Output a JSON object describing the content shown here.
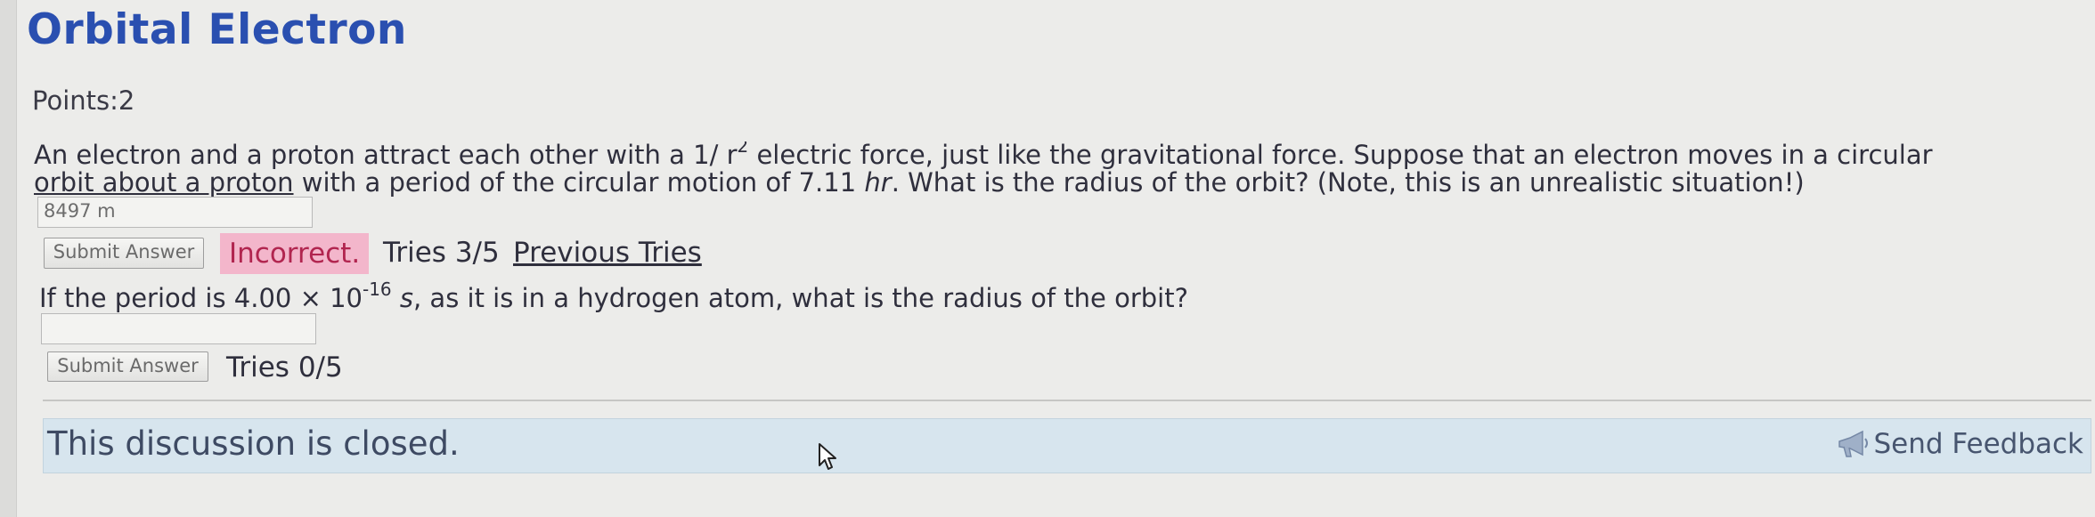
{
  "page": {
    "title": "Orbital Electron",
    "points": "Points:2"
  },
  "problem": {
    "line1_a": "An electron and a proton attract each other with a 1/ r",
    "line1_sup": "2",
    "line1_b": " electric force, just like the gravitational force. Suppose that an electron moves in a circular",
    "line2_a": "orbit about a proton",
    "line2_b": " with a period of the circular motion of 7.11 ",
    "line2_unit": "hr",
    "line2_c": ". What is the radius of the orbit? (Note, this is an unrealistic situation!)"
  },
  "part1": {
    "answer_value": "8497 m",
    "submit_label": "Submit Answer",
    "status": "Incorrect.",
    "tries": "Tries 3/5",
    "previous_tries": "Previous Tries"
  },
  "part2": {
    "question_a": "If the period is 4.00 × 10",
    "question_sup": "-16",
    "question_unit": "s",
    "question_b": ", as it is in a hydrogen atom, what is the radius of the orbit?",
    "answer_value": "",
    "submit_label": "Submit Answer",
    "tries": "Tries 0/5"
  },
  "discussion": {
    "closed_text": "This discussion is closed.",
    "feedback_label": "Send Feedback",
    "feedback_icon": "megaphone-icon"
  },
  "colors": {
    "title": "#2a4fb0",
    "incorrect_bg": "#f3b6cb",
    "incorrect_text": "#b1254f",
    "discussion_bg": "#d7e5ee"
  }
}
